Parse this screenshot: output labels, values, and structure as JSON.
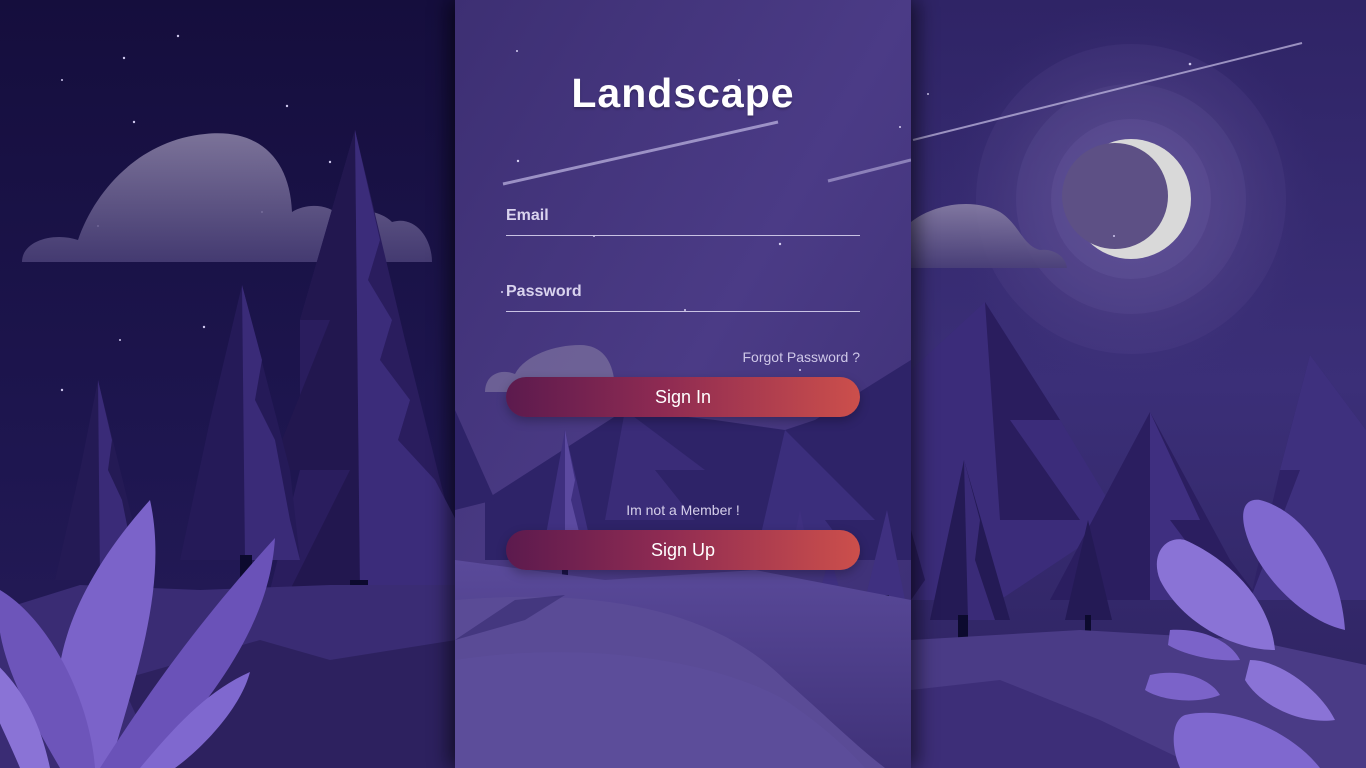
{
  "form": {
    "title": "Landscape",
    "email_label": "Email",
    "email_value": "",
    "password_label": "Password",
    "password_value": "",
    "forgot_link": "Forgot Password ?",
    "sign_in_label": "Sign In",
    "not_member_text": "Im not a Member !",
    "sign_up_label": "Sign Up"
  },
  "colors": {
    "background_dark": "#1d1548",
    "panel_purple": "#4b3b82",
    "button_gradient_start": "#5c1a4e",
    "button_gradient_end": "#cc4f4b",
    "moon": "#d9d9d9"
  },
  "icons": [
    "moon-icon",
    "cloud-icon",
    "pine-tree-icon",
    "leaf-icon",
    "shooting-star-icon",
    "star-icon"
  ]
}
